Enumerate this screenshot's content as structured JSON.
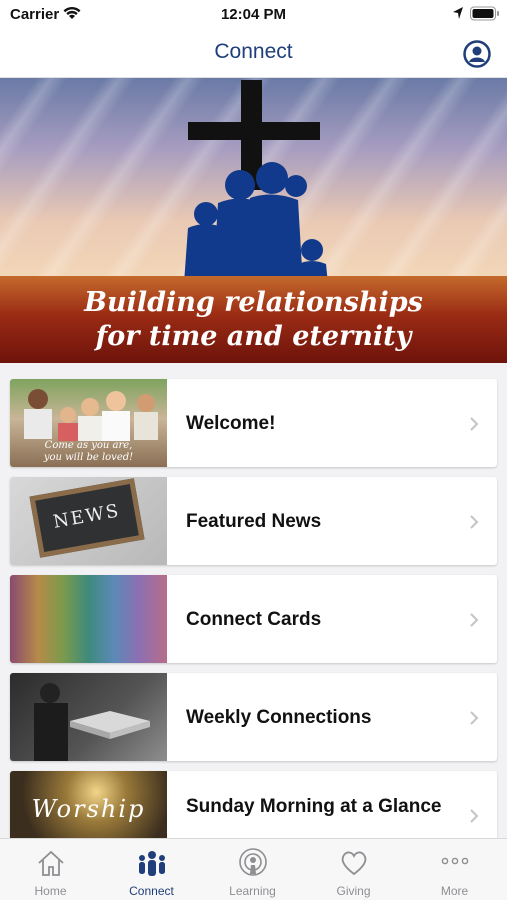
{
  "status_bar": {
    "carrier": "Carrier",
    "time": "12:04 PM"
  },
  "nav": {
    "title": "Connect",
    "profile_icon": "person-circle-icon"
  },
  "hero": {
    "tagline_line1": "Building relationships",
    "tagline_line2": "for time and eternity"
  },
  "list": {
    "items": [
      {
        "label": "Welcome!",
        "thumb_line1": "Come as you are,",
        "thumb_line2": "you will be loved!"
      },
      {
        "label": "Featured News",
        "thumb_word": "NEWS"
      },
      {
        "label": "Connect Cards"
      },
      {
        "label": "Weekly Connections"
      },
      {
        "label": "Sunday Morning at a Glance",
        "thumb_word": "Worship"
      }
    ]
  },
  "tab_bar": {
    "active": "Connect",
    "tabs": [
      {
        "label": "Home",
        "icon": "house-icon"
      },
      {
        "label": "Connect",
        "icon": "people-icon"
      },
      {
        "label": "Learning",
        "icon": "podcast-icon"
      },
      {
        "label": "Giving",
        "icon": "heart-icon"
      },
      {
        "label": "More",
        "icon": "ellipsis-icon"
      }
    ]
  },
  "colors": {
    "accent": "#1f3e7a",
    "inactive": "#8e8e93",
    "banner": "#9a2b14"
  }
}
